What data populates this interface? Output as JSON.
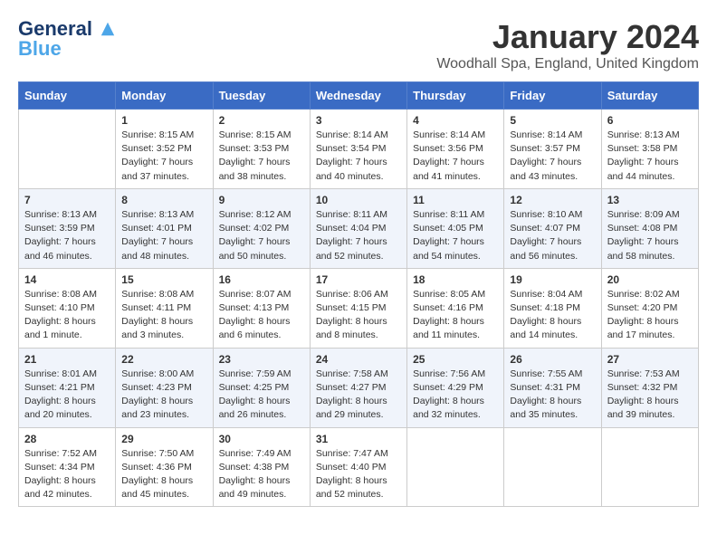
{
  "logo": {
    "line1": "General",
    "line2": "Blue"
  },
  "title": "January 2024",
  "location": "Woodhall Spa, England, United Kingdom",
  "days_of_week": [
    "Sunday",
    "Monday",
    "Tuesday",
    "Wednesday",
    "Thursday",
    "Friday",
    "Saturday"
  ],
  "weeks": [
    [
      {
        "day": "",
        "info": ""
      },
      {
        "day": "1",
        "info": "Sunrise: 8:15 AM\nSunset: 3:52 PM\nDaylight: 7 hours\nand 37 minutes."
      },
      {
        "day": "2",
        "info": "Sunrise: 8:15 AM\nSunset: 3:53 PM\nDaylight: 7 hours\nand 38 minutes."
      },
      {
        "day": "3",
        "info": "Sunrise: 8:14 AM\nSunset: 3:54 PM\nDaylight: 7 hours\nand 40 minutes."
      },
      {
        "day": "4",
        "info": "Sunrise: 8:14 AM\nSunset: 3:56 PM\nDaylight: 7 hours\nand 41 minutes."
      },
      {
        "day": "5",
        "info": "Sunrise: 8:14 AM\nSunset: 3:57 PM\nDaylight: 7 hours\nand 43 minutes."
      },
      {
        "day": "6",
        "info": "Sunrise: 8:13 AM\nSunset: 3:58 PM\nDaylight: 7 hours\nand 44 minutes."
      }
    ],
    [
      {
        "day": "7",
        "info": "Sunrise: 8:13 AM\nSunset: 3:59 PM\nDaylight: 7 hours\nand 46 minutes."
      },
      {
        "day": "8",
        "info": "Sunrise: 8:13 AM\nSunset: 4:01 PM\nDaylight: 7 hours\nand 48 minutes."
      },
      {
        "day": "9",
        "info": "Sunrise: 8:12 AM\nSunset: 4:02 PM\nDaylight: 7 hours\nand 50 minutes."
      },
      {
        "day": "10",
        "info": "Sunrise: 8:11 AM\nSunset: 4:04 PM\nDaylight: 7 hours\nand 52 minutes."
      },
      {
        "day": "11",
        "info": "Sunrise: 8:11 AM\nSunset: 4:05 PM\nDaylight: 7 hours\nand 54 minutes."
      },
      {
        "day": "12",
        "info": "Sunrise: 8:10 AM\nSunset: 4:07 PM\nDaylight: 7 hours\nand 56 minutes."
      },
      {
        "day": "13",
        "info": "Sunrise: 8:09 AM\nSunset: 4:08 PM\nDaylight: 7 hours\nand 58 minutes."
      }
    ],
    [
      {
        "day": "14",
        "info": "Sunrise: 8:08 AM\nSunset: 4:10 PM\nDaylight: 8 hours\nand 1 minute."
      },
      {
        "day": "15",
        "info": "Sunrise: 8:08 AM\nSunset: 4:11 PM\nDaylight: 8 hours\nand 3 minutes."
      },
      {
        "day": "16",
        "info": "Sunrise: 8:07 AM\nSunset: 4:13 PM\nDaylight: 8 hours\nand 6 minutes."
      },
      {
        "day": "17",
        "info": "Sunrise: 8:06 AM\nSunset: 4:15 PM\nDaylight: 8 hours\nand 8 minutes."
      },
      {
        "day": "18",
        "info": "Sunrise: 8:05 AM\nSunset: 4:16 PM\nDaylight: 8 hours\nand 11 minutes."
      },
      {
        "day": "19",
        "info": "Sunrise: 8:04 AM\nSunset: 4:18 PM\nDaylight: 8 hours\nand 14 minutes."
      },
      {
        "day": "20",
        "info": "Sunrise: 8:02 AM\nSunset: 4:20 PM\nDaylight: 8 hours\nand 17 minutes."
      }
    ],
    [
      {
        "day": "21",
        "info": "Sunrise: 8:01 AM\nSunset: 4:21 PM\nDaylight: 8 hours\nand 20 minutes."
      },
      {
        "day": "22",
        "info": "Sunrise: 8:00 AM\nSunset: 4:23 PM\nDaylight: 8 hours\nand 23 minutes."
      },
      {
        "day": "23",
        "info": "Sunrise: 7:59 AM\nSunset: 4:25 PM\nDaylight: 8 hours\nand 26 minutes."
      },
      {
        "day": "24",
        "info": "Sunrise: 7:58 AM\nSunset: 4:27 PM\nDaylight: 8 hours\nand 29 minutes."
      },
      {
        "day": "25",
        "info": "Sunrise: 7:56 AM\nSunset: 4:29 PM\nDaylight: 8 hours\nand 32 minutes."
      },
      {
        "day": "26",
        "info": "Sunrise: 7:55 AM\nSunset: 4:31 PM\nDaylight: 8 hours\nand 35 minutes."
      },
      {
        "day": "27",
        "info": "Sunrise: 7:53 AM\nSunset: 4:32 PM\nDaylight: 8 hours\nand 39 minutes."
      }
    ],
    [
      {
        "day": "28",
        "info": "Sunrise: 7:52 AM\nSunset: 4:34 PM\nDaylight: 8 hours\nand 42 minutes."
      },
      {
        "day": "29",
        "info": "Sunrise: 7:50 AM\nSunset: 4:36 PM\nDaylight: 8 hours\nand 45 minutes."
      },
      {
        "day": "30",
        "info": "Sunrise: 7:49 AM\nSunset: 4:38 PM\nDaylight: 8 hours\nand 49 minutes."
      },
      {
        "day": "31",
        "info": "Sunrise: 7:47 AM\nSunset: 4:40 PM\nDaylight: 8 hours\nand 52 minutes."
      },
      {
        "day": "",
        "info": ""
      },
      {
        "day": "",
        "info": ""
      },
      {
        "day": "",
        "info": ""
      }
    ]
  ]
}
